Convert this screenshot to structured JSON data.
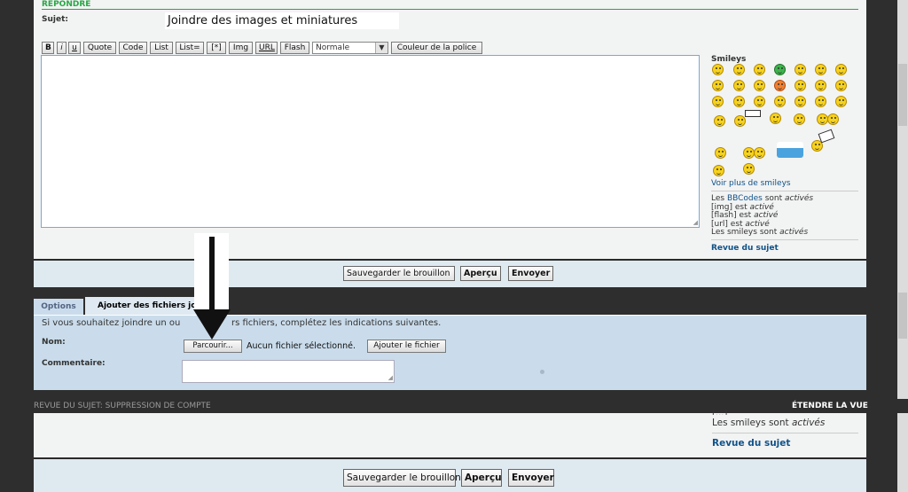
{
  "top": {
    "section_label": "RÉPONDRE",
    "subject_label": "Sujet:",
    "subject_value": "Joindre des images et miniatures",
    "toolbar": {
      "b": "B",
      "i": "i",
      "u": "u",
      "quote": "Quote",
      "code": "Code",
      "list": "List",
      "list_num": "List=",
      "list_item": "[*]",
      "img": "Img",
      "url": "URL",
      "flash": "Flash",
      "font_size": "Normale",
      "font_color": "Couleur de la police"
    },
    "smileys": {
      "title": "Smileys",
      "more_link": "Voir plus de smileys",
      "status": {
        "bbcodes_prefix": "Les ",
        "bbcodes_link": "BBCodes",
        "bbcodes_mid": " sont ",
        "bbcodes_state": "activés",
        "img_text": "[img] est ",
        "img_state": "activé",
        "flash_text": "[flash] est ",
        "flash_state": "activé",
        "url_text": "[url] est ",
        "url_state": "activé",
        "smileys_text": "Les smileys sont ",
        "smileys_state": "activés"
      },
      "review_link": "Revue du sujet"
    },
    "buttons": {
      "save_draft": "Sauvegarder le brouillon",
      "preview": "Aperçu",
      "send": "Envoyer"
    }
  },
  "attach": {
    "tabs": {
      "options": "Options",
      "attachments": "Ajouter des fichiers jo"
    },
    "intro_left": "Si vous souhaitez joindre un ou",
    "intro_right": "rs fichiers, complétez les indications suivantes.",
    "name_label": "Nom:",
    "browse_button": "Parcourir...",
    "no_file": "Aucun fichier sélectionné.",
    "add_file_button": "Ajouter le fichier",
    "comment_label": "Commentaire:"
  },
  "review_bar": {
    "left": "REVUE DU SUJET: SUPPRESSION DE COMPTE",
    "right": "ÉTENDRE LA VUE"
  },
  "bottom": {
    "partial_text": "[...]",
    "smileys_text": "Les smileys sont ",
    "smileys_state": "activés",
    "review_link": "Revue du sujet",
    "buttons": {
      "save_draft": "Sauvegarder le brouillon",
      "preview": "Aperçu",
      "send": "Envoyer"
    }
  },
  "colors": {
    "panel": "#f2f3f3",
    "blue_panel": "#cadceb",
    "link": "#105289",
    "green_rule": "#28a745"
  }
}
